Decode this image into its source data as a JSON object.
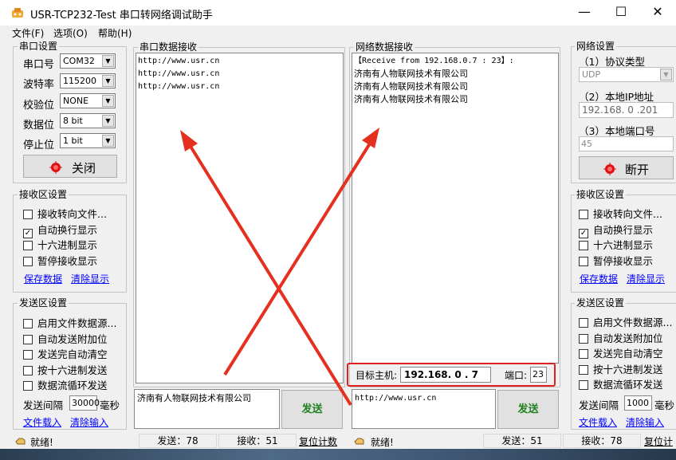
{
  "window": {
    "title": "USR-TCP232-Test 串口转网络调试助手",
    "minimize": "—",
    "maximize": "☐",
    "close": "✕"
  },
  "menu": [
    "文件(F)",
    "选项(O)",
    "帮助(H)"
  ],
  "serial_settings": {
    "title": "串口设置",
    "rows": [
      {
        "label": "串口号",
        "value": "COM32"
      },
      {
        "label": "波特率",
        "value": "115200"
      },
      {
        "label": "校验位",
        "value": "NONE"
      },
      {
        "label": "数据位",
        "value": "8 bit"
      },
      {
        "label": "停止位",
        "value": "1 bit"
      }
    ],
    "close_button": "关闭"
  },
  "serial_receive_settings": {
    "title": "接收区设置",
    "options": [
      {
        "label": "接收转向文件...",
        "checked": false
      },
      {
        "label": "自动换行显示",
        "checked": true
      },
      {
        "label": "十六进制显示",
        "checked": false
      },
      {
        "label": "暂停接收显示",
        "checked": false
      }
    ],
    "save_link": "保存数据",
    "clear_link": "清除显示"
  },
  "serial_send_settings": {
    "title": "发送区设置",
    "options": [
      {
        "label": "启用文件数据源...",
        "checked": false
      },
      {
        "label": "自动发送附加位",
        "checked": false
      },
      {
        "label": "发送完自动清空",
        "checked": false
      },
      {
        "label": "按十六进制发送",
        "checked": false
      },
      {
        "label": "数据流循环发送",
        "checked": false
      }
    ],
    "interval_label": "发送间隔",
    "interval_value": "30000",
    "interval_unit": "毫秒",
    "load_link": "文件载入",
    "clear_link": "清除输入"
  },
  "serial_receive": {
    "title": "串口数据接收",
    "lines": [
      "http://www.usr.cn",
      "http://www.usr.cn",
      "http://www.usr.cn"
    ]
  },
  "serial_send": {
    "text": "济南有人物联网技术有限公司",
    "button": "发送"
  },
  "net_receive": {
    "title": "网络数据接收",
    "lines": [
      "【Receive from 192.168.0.7 : 23】:",
      "济南有人物联网技术有限公司",
      "济南有人物联网技术有限公司",
      "济南有人物联网技术有限公司"
    ]
  },
  "target": {
    "host_label": "目标主机:",
    "host_value": "192.168. 0 . 7",
    "port_label": "端口:",
    "port_value": "23"
  },
  "net_send": {
    "text": "http://www.usr.cn",
    "button": "发送"
  },
  "net_settings": {
    "title": "网络设置",
    "protocol_label": "（1）协议类型",
    "protocol_value": "UDP",
    "ip_label": "（2）本地IP地址",
    "ip_value": "192.168. 0 .201",
    "port_label": "（3）本地端口号",
    "port_value": "45",
    "disconnect_button": "断开"
  },
  "net_receive_settings": {
    "title": "接收区设置",
    "options": [
      {
        "label": "接收转向文件...",
        "checked": false
      },
      {
        "label": "自动换行显示",
        "checked": true
      },
      {
        "label": "十六进制显示",
        "checked": false
      },
      {
        "label": "暂停接收显示",
        "checked": false
      }
    ],
    "save_link": "保存数据",
    "clear_link": "清除显示"
  },
  "net_send_settings": {
    "title": "发送区设置",
    "options": [
      {
        "label": "启用文件数据源...",
        "checked": false
      },
      {
        "label": "自动发送附加位",
        "checked": false
      },
      {
        "label": "发送完自动清空",
        "checked": false
      },
      {
        "label": "按十六进制发送",
        "checked": false
      },
      {
        "label": "数据流循环发送",
        "checked": false
      }
    ],
    "interval_label": "发送间隔",
    "interval_value": "1000",
    "interval_unit": "毫秒",
    "load_link": "文件载入",
    "clear_link": "清除输入"
  },
  "status_left": {
    "ready": "就绪!",
    "sent": "发送：78",
    "received": "接收：51",
    "reset": "复位计数"
  },
  "status_right": {
    "ready": "就绪!",
    "sent": "发送：51",
    "received": "接收：78",
    "reset": "复位计"
  },
  "check_mark": "✓",
  "colors": {
    "arrow": "#e53020",
    "highlight": "#e02020",
    "send_button_text": "#208020",
    "link": "#0000ff"
  }
}
